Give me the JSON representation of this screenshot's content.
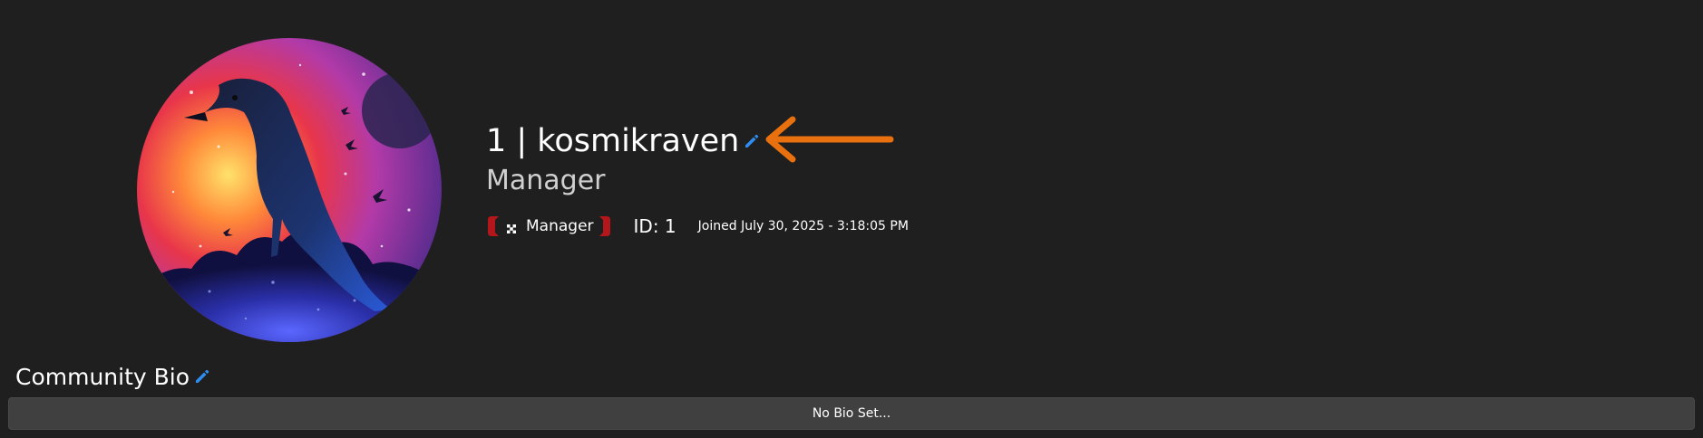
{
  "profile": {
    "username_line": "1 | kosmikraven",
    "role_title": "Manager",
    "badge": {
      "label": "Manager",
      "icon": "dice-icon",
      "color": "#b3161b"
    },
    "id_text": "ID: 1",
    "joined_text": "Joined July 30, 2025 - 3:18:05 PM",
    "avatar_icon": "raven-avatar"
  },
  "bio": {
    "heading": "Community Bio",
    "content": "No Bio Set..."
  },
  "colors": {
    "background": "#1f1f1f",
    "edit_icon": "#2f8cf0",
    "arrow": "#e8700f",
    "bio_box": "#404040"
  }
}
